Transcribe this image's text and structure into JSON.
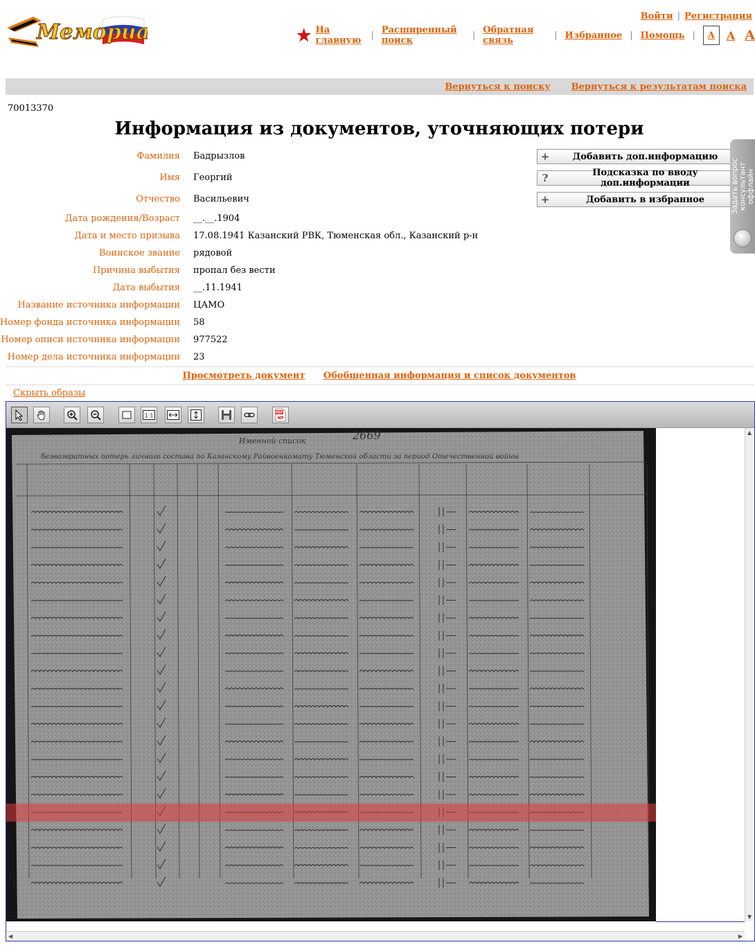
{
  "header": {
    "logo_text": "Мемориал",
    "login": "Войти",
    "register": "Регистрация",
    "nav": [
      "На главную",
      "Расширенный поиск",
      "Обратная связь",
      "Избранное",
      "Помощь"
    ],
    "font_sizes": [
      "A",
      "A",
      "A"
    ]
  },
  "subnav": {
    "back_to_search": "Вернуться к поиску",
    "back_to_results": "Вернуться к результатам поиска"
  },
  "record_id": "70013370",
  "page_title": "Информация из документов, уточняющих потери",
  "fields": [
    {
      "label": "Фамилия",
      "value": "Бадрызлов"
    },
    {
      "label": "Имя",
      "value": "Георгий"
    },
    {
      "label": "Отчество",
      "value": "Васильевич"
    },
    {
      "label": "Дата рождения/Возраст",
      "value": "__.__.1904"
    },
    {
      "label": "Дата и место призыва",
      "value": "17.08.1941 Казанский РВК, Тюменская обл., Казанский р-н"
    },
    {
      "label": "Воинское звание",
      "value": "рядовой"
    },
    {
      "label": "Причина выбытия",
      "value": "пропал без вести"
    },
    {
      "label": "Дата выбытия",
      "value": "__.11.1941"
    },
    {
      "label": "Название источника информации",
      "value": "ЦАМО"
    },
    {
      "label": "Номер фонда источника информации",
      "value": "58"
    },
    {
      "label": "Номер описи источника информации",
      "value": "977522"
    },
    {
      "label": "Номер дела источника информации",
      "value": "23"
    }
  ],
  "side_buttons": [
    {
      "icon": "+",
      "label": "Добавить доп.информацию"
    },
    {
      "icon": "?",
      "label": "Подсказка по вводу доп.информации"
    },
    {
      "icon": "+",
      "label": "Добавить в избранное"
    }
  ],
  "feedback_tab": {
    "line1": "Задать вопрос",
    "line2": "консультант оффлайн"
  },
  "doc_links": {
    "view_document": "Просмотреть документ",
    "summary": "Обобщенная информация и список документов"
  },
  "hide_images": "Скрыть образы",
  "viewer": {
    "tools": [
      "select-arrow",
      "pan-hand",
      "zoom-in",
      "zoom-out",
      "fit-page",
      "actual-size",
      "fit-width",
      "fit-height",
      "save",
      "link",
      "pdf"
    ],
    "doc_header": "Именной список",
    "doc_number": "2669",
    "doc_subtitle": "безвозвратных потерь личного состава по Казанскому Райвоенкомату Тюменской области за период Отечественной войны",
    "highlighted_row": 18
  },
  "colors": {
    "link": "#e0620a",
    "highlight": "#e23a3a",
    "viewer_border": "#2a3ca8"
  }
}
